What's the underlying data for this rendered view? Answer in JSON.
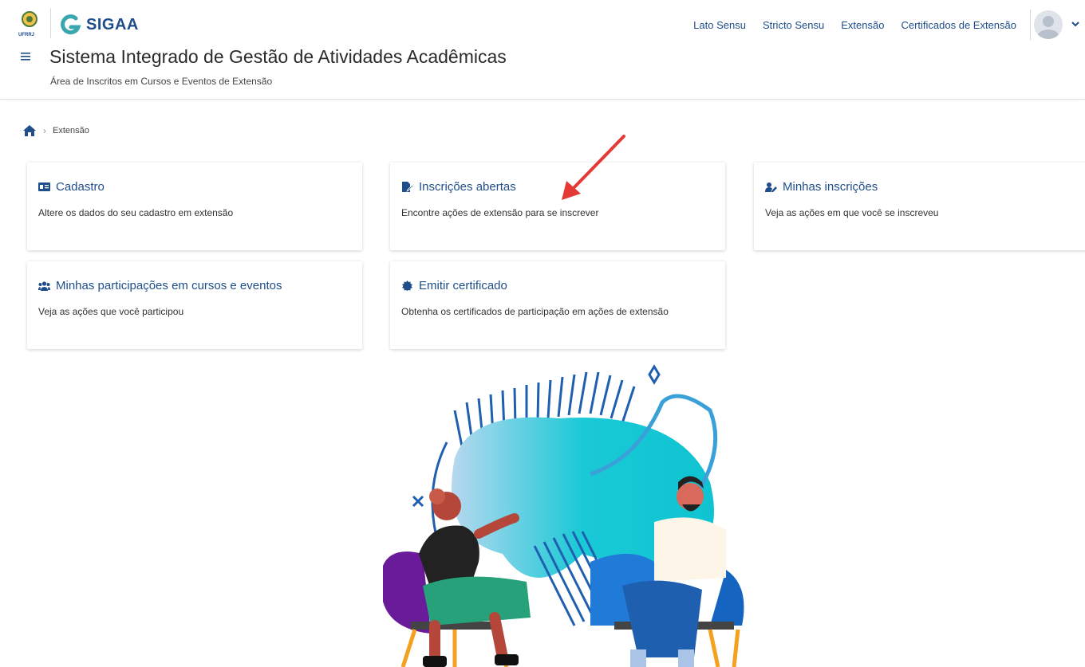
{
  "header": {
    "university_abbr": "UFRRJ",
    "app_name": "SIGAA",
    "nav": [
      "Lato Sensu",
      "Stricto Sensu",
      "Extensão",
      "Certificados de Extensão"
    ],
    "title": "Sistema Integrado de Gestão de Atividades Acadêmicas",
    "subtitle": "Área de Inscritos em Cursos e Eventos de Extensão"
  },
  "breadcrumb": {
    "home_icon": "home-icon",
    "current": "Extensão"
  },
  "cards": [
    {
      "title": "Cadastro",
      "description": "Altere os dados do seu cadastro em extensão",
      "icon": "id-card-icon"
    },
    {
      "title": "Inscrições abertas",
      "description": "Encontre ações de extensão para se inscrever",
      "icon": "edit-file-icon"
    },
    {
      "title": "Minhas inscrições",
      "description": "Veja as ações em que você se inscreveu",
      "icon": "user-edit-icon"
    },
    {
      "title": "Minhas participações em cursos e eventos",
      "description": "Veja as ações que você participou",
      "icon": "users-icon"
    },
    {
      "title": "Emitir certificado",
      "description": "Obtenha os certificados de participação em ações de extensão",
      "icon": "certificate-icon"
    }
  ],
  "colors": {
    "brand": "#1f4e8a",
    "accent_arrow": "#e53935",
    "illustration_teal": "#19c9d6",
    "illustration_blue": "#1f5fb0"
  }
}
